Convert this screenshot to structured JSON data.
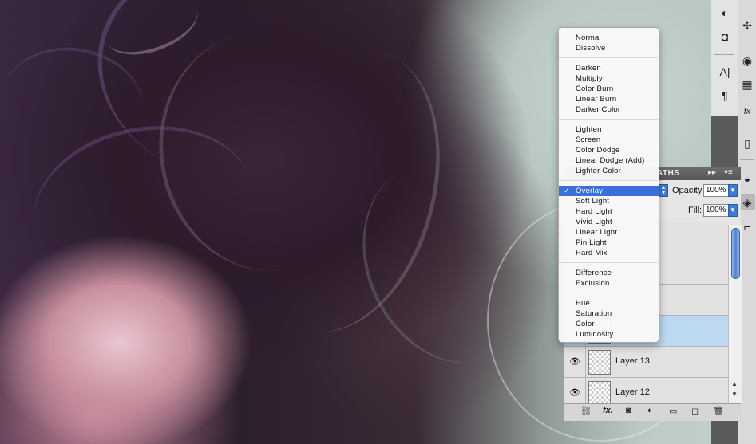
{
  "blend_menu": {
    "groups": [
      [
        "Normal",
        "Dissolve"
      ],
      [
        "Darken",
        "Multiply",
        "Color Burn",
        "Linear Burn",
        "Darker Color"
      ],
      [
        "Lighten",
        "Screen",
        "Color Dodge",
        "Linear Dodge (Add)",
        "Lighter Color"
      ],
      [
        "Overlay",
        "Soft Light",
        "Hard Light",
        "Vivid Light",
        "Linear Light",
        "Pin Light",
        "Hard Mix"
      ],
      [
        "Difference",
        "Exclusion"
      ],
      [
        "Hue",
        "Saturation",
        "Color",
        "Luminosity"
      ]
    ],
    "selected": "Overlay",
    "check_glyph": "✓"
  },
  "layers_panel": {
    "tab_label": "ATHS",
    "forward_glyph": "▸▸",
    "menu_glyph": "▾≡",
    "opacity_label": "Opacity:",
    "opacity_value": "100%",
    "fill_label": "Fill:",
    "fill_value": "100%",
    "layers": [
      {
        "name": "Layer 13",
        "visible": true
      },
      {
        "name": "Layer 12",
        "visible": true
      }
    ],
    "eye_glyph": "👁",
    "footer_icons": [
      "link-icon",
      "fx-icon",
      "mask-icon",
      "adjustment-icon",
      "folder-icon",
      "new-layer-icon",
      "trash-icon"
    ],
    "footer_glyphs": [
      "⛓",
      "fx.",
      "◙",
      "◐",
      "▭",
      "◻",
      "🗑"
    ]
  },
  "toolbar": {
    "col1_icons": [
      "brush-icon",
      "mask-icon",
      "type-icon",
      "paragraph-icon"
    ],
    "col1_glyphs": [
      "◐",
      "◘",
      "A|",
      "¶"
    ],
    "col2_icons": [
      "tool-icon",
      "palette-icon",
      "grid-icon",
      "fx-icon",
      "info-icon",
      "layers-icon",
      "paint-icon",
      "transform-icon"
    ],
    "col2_glyphs": [
      "✣",
      "◉",
      "▦",
      "fx",
      "▯",
      "◒",
      "◈",
      "⌐"
    ]
  }
}
